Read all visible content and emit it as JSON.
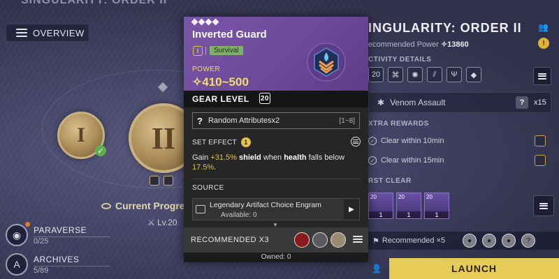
{
  "left": {
    "top_title": "SINGULARITY: ORDER II",
    "overview_label": "OVERVIEW",
    "medal_1": "I",
    "medal_2": "II",
    "progress_label": "Current Progres",
    "level": "Lv.20",
    "paraverse": {
      "label": "PARAVERSE",
      "value": "0/25"
    },
    "archives": {
      "label": "ARCHIVES",
      "value": "5/89"
    }
  },
  "right": {
    "title": "INGULARITY: ORDER II",
    "recommended_power_label": "ecommended Power",
    "recommended_power_value": "✧13860",
    "activity_details": "CTIVITY DETAILS",
    "mod_values": [
      "20",
      "",
      "",
      "",
      "",
      ""
    ],
    "venom": {
      "label": "Venom Assault",
      "count": "x15"
    },
    "extra_rewards": "XTRA REWARDS",
    "rewards": [
      "Clear within 10min",
      "Clear within 15min"
    ],
    "first_clear": "RST CLEAR",
    "first_clear_items": [
      {
        "level": "20",
        "count": "1"
      },
      {
        "level": "20",
        "count": "1"
      },
      {
        "level": "20",
        "count": "1"
      }
    ],
    "recommended": "Recommended ×5",
    "launch": "LAUNCH"
  },
  "card": {
    "title": "Inverted Guard",
    "tier": "I",
    "category": "Survival",
    "power_label": "POWER",
    "power_value": "✧410~500",
    "gear_level_label": "GEAR LEVEL",
    "gear_level_value": "20",
    "random_attr": "Random Attributesx2",
    "random_range": "[1~8]",
    "set_effect_label": "SET EFFECT",
    "set_effect_count": "1",
    "effect": {
      "gain": "Gain ",
      "pct1": "+31.5%",
      "shield": "shield",
      "mid": " when ",
      "health": "health",
      "end": " falls below ",
      "pct2": "17.5%",
      "dot": "."
    },
    "source_label": "SOURCE",
    "source_name": "Legendary Artifact Choice Engram",
    "source_available": "Available: 0",
    "recommended_label": "RECOMMENDED X3",
    "owned": "Owned: 0"
  },
  "colors": {
    "header_purple": "#7b56a8",
    "power_yellow": "#f0dc72",
    "tag_green": "#7fb06a",
    "launch_yellow": "#e6cc56",
    "highlight": "#e4c34a"
  }
}
